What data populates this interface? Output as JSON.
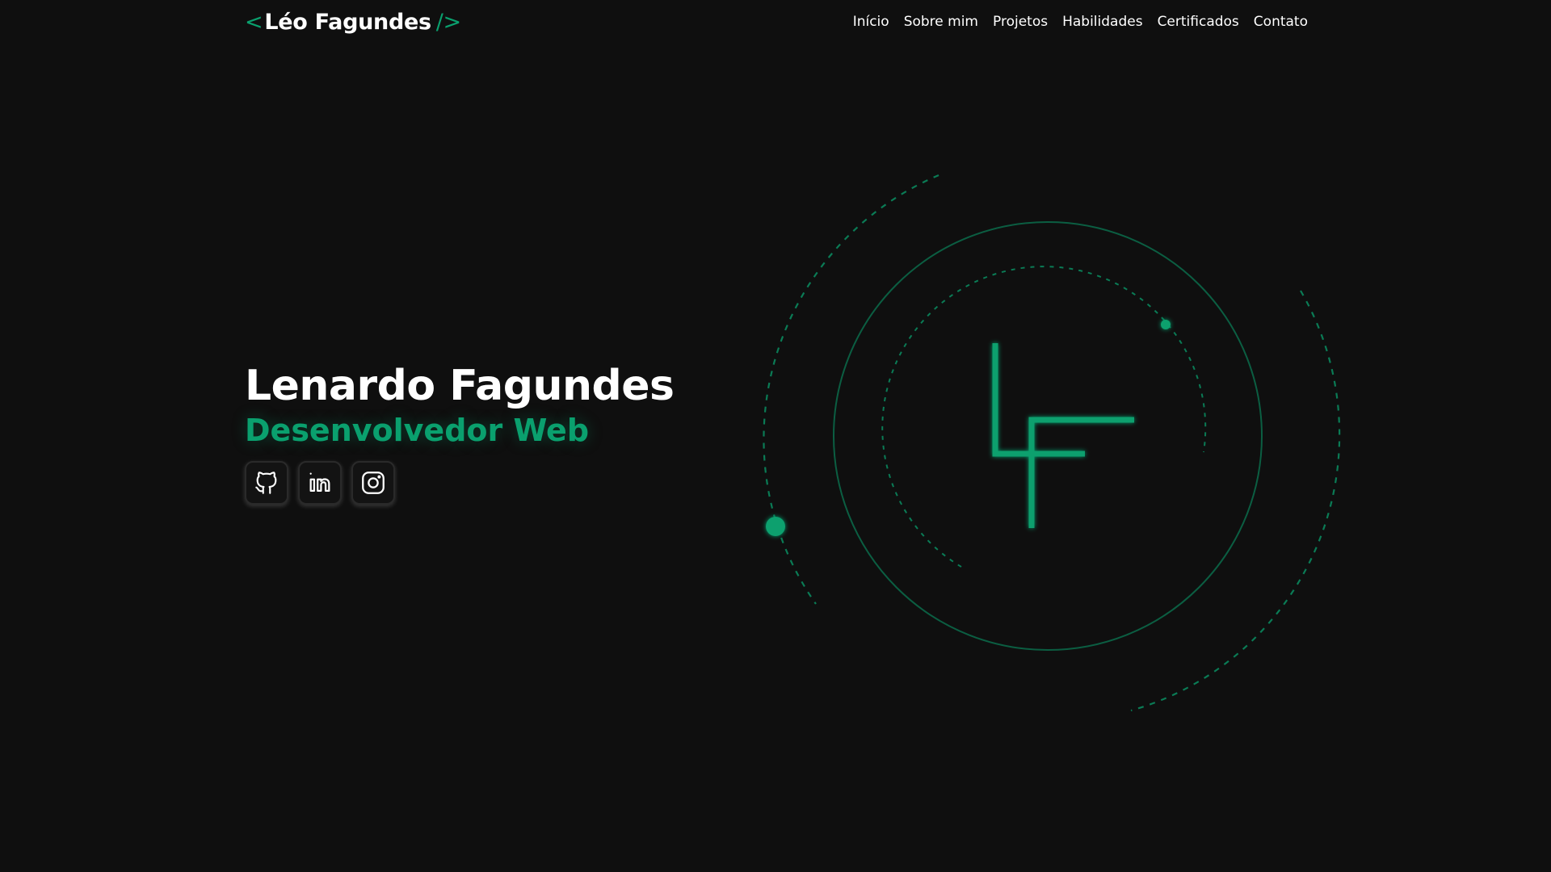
{
  "header": {
    "logo": {
      "open": "<",
      "name": "Léo Fagundes",
      "close": "/>"
    },
    "nav": [
      "Início",
      "Sobre mim",
      "Projetos",
      "Habilidades",
      "Certificados",
      "Contato"
    ]
  },
  "hero": {
    "name": "Lenardo Fagundes",
    "role": "Desenvolvedor Web",
    "socials": [
      {
        "icon": "github-icon"
      },
      {
        "icon": "linkedin-icon"
      },
      {
        "icon": "instagram-icon"
      }
    ]
  },
  "graphic": {
    "monogram": "LF",
    "accent": "#0aa06e"
  },
  "colors": {
    "background": "#0f0f0f",
    "accent": "#0aa06e",
    "text": "#ffffff"
  }
}
